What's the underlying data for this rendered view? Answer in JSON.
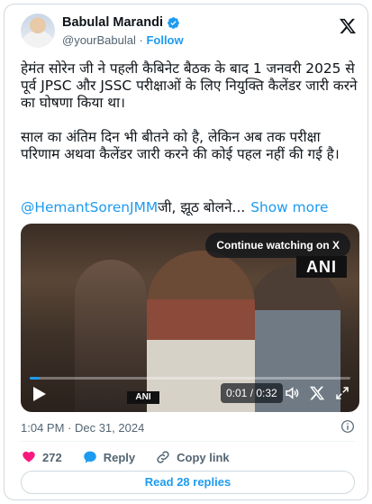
{
  "author": {
    "name": "Babulal Marandi",
    "handle": "@yourBabulal",
    "separator": "·",
    "follow_label": "Follow"
  },
  "tweet": {
    "paragraph1": "हेमंत सोरेन जी ने पहली कैबिनेट बैठक के बाद 1 जनवरी 2025 से पूर्व JPSC और JSSC परीक्षाओं के लिए नियुक्ति कैलेंडर जारी करने का घोषणा किया था।",
    "paragraph2": "साल का अंतिम दिन भी बीतने को है, लेकिन अब तक परीक्षा परिणाम अथवा कैलेंडर जारी करने की कोई पहल नहीं की गई है।",
    "mention": "@HemantSorenJMM",
    "mention_suffix": "जी, झूठ बोलने...",
    "show_more": "Show more"
  },
  "video": {
    "continue_label": "Continue watching on X",
    "watermark": "ANI",
    "mic_label": "ANI",
    "time_display": "0:01 / 0:32",
    "progress_fraction": 0.03
  },
  "meta": {
    "timestamp": "1:04 PM · Dec 31, 2024"
  },
  "actions": {
    "likes": "272",
    "reply_label": "Reply",
    "copy_link_label": "Copy link"
  },
  "read_replies": "Read 28 replies",
  "colors": {
    "accent": "#1d9bf0",
    "like": "#f91880",
    "text": "#0f1419",
    "muted": "#536471",
    "border": "#cfd9de"
  },
  "icons": [
    "verified-badge-icon",
    "x-logo-icon",
    "play-icon",
    "volume-icon",
    "x-watermark-icon",
    "fullscreen-icon",
    "info-icon",
    "heart-icon",
    "reply-bubble-icon",
    "link-icon"
  ]
}
